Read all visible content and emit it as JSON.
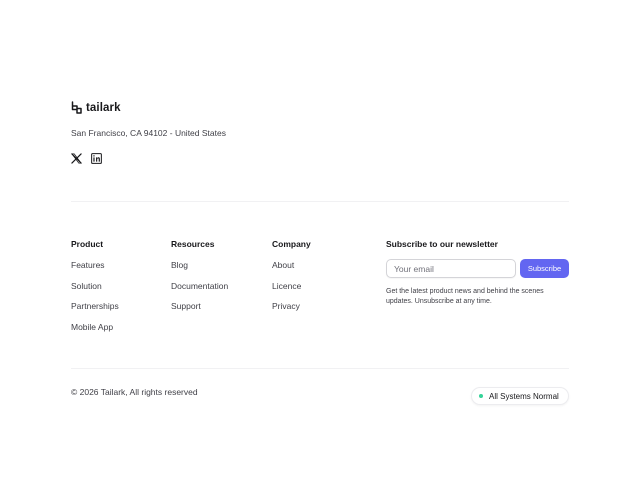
{
  "brand": {
    "name": "tailark",
    "icon": "tailark-logo-icon"
  },
  "address": "San Francisco, CA 94102 - United States",
  "socials": [
    {
      "name": "x-icon"
    },
    {
      "name": "linkedin-icon"
    }
  ],
  "columns": {
    "product": {
      "title": "Product",
      "links": [
        "Features",
        "Solution",
        "Partnerships",
        "Mobile App"
      ]
    },
    "resources": {
      "title": "Resources",
      "links": [
        "Blog",
        "Documentation",
        "Support"
      ]
    },
    "company": {
      "title": "Company",
      "links": [
        "About",
        "Licence",
        "Privacy"
      ]
    }
  },
  "newsletter": {
    "title": "Subscribe to our newsletter",
    "placeholder": "Your email",
    "button_label": "Subscribe",
    "note": "Get the latest product news and behind the scenes updates. Unsubscribe at any time."
  },
  "copyright": "© 2026 Tailark, All rights reserved",
  "status": {
    "label": "All Systems Normal",
    "color": "#34d399"
  },
  "colors": {
    "accent": "#6366f1",
    "text": "#18181b",
    "muted": "#3f3f46"
  }
}
